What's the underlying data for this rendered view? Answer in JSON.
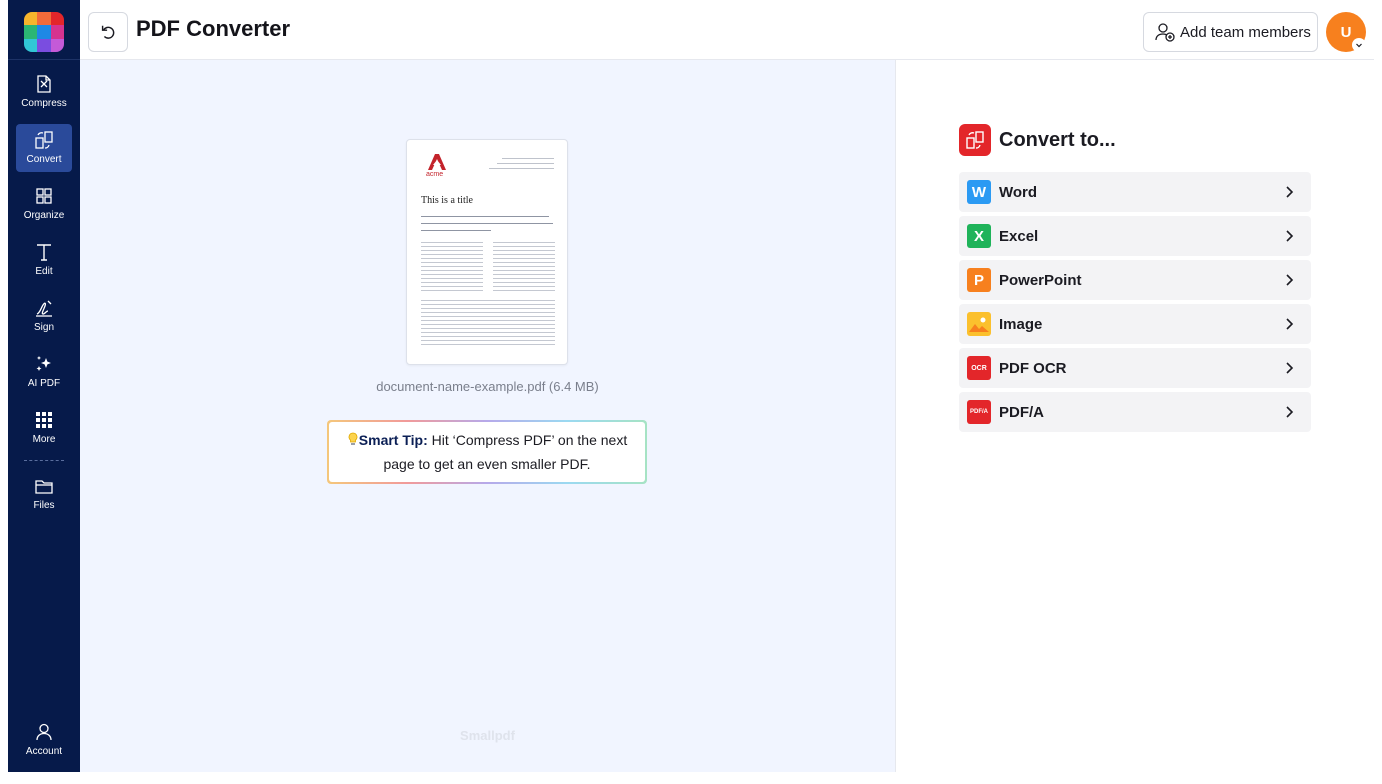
{
  "app": {
    "title": "PDF Converter"
  },
  "sidebar": {
    "items": [
      {
        "label": "Compress",
        "icon": "compress-icon"
      },
      {
        "label": "Convert",
        "icon": "convert-icon",
        "active": true
      },
      {
        "label": "Organize",
        "icon": "organize-icon"
      },
      {
        "label": "Edit",
        "icon": "edit-icon"
      },
      {
        "label": "Sign",
        "icon": "sign-icon"
      },
      {
        "label": "AI PDF",
        "icon": "sparkle-icon"
      },
      {
        "label": "More",
        "icon": "grid-dots-icon"
      },
      {
        "label": "Files",
        "icon": "folder-icon"
      }
    ],
    "account_label": "Account"
  },
  "header": {
    "team_button_label": "Add team members",
    "avatar_initial": "U"
  },
  "document": {
    "file_name": "document-name-example.pdf (6.4 MB)",
    "preview_title": "This is a title",
    "preview_logo": "acme"
  },
  "tip": {
    "label": "Smart Tip:",
    "text": "Hit ‘Compress PDF’ on the next page to get an even smaller PDF."
  },
  "watermark": "Smallpdf",
  "convert": {
    "title": "Convert to...",
    "options": [
      {
        "label": "Word",
        "icon": "word-icon",
        "glyph": "W",
        "color": "#2b9af3"
      },
      {
        "label": "Excel",
        "icon": "excel-icon",
        "glyph": "X",
        "color": "#1fb35a"
      },
      {
        "label": "PowerPoint",
        "icon": "powerpoint-icon",
        "glyph": "P",
        "color": "#f7801e"
      },
      {
        "label": "Image",
        "icon": "image-icon",
        "glyph": "",
        "color": "#fbc02d"
      },
      {
        "label": "PDF OCR",
        "icon": "pdf-ocr-icon",
        "glyph": "OCR",
        "color": "#e3262a"
      },
      {
        "label": "PDF/A",
        "icon": "pdf-a-icon",
        "glyph": "PDF/A",
        "color": "#e3262a"
      }
    ]
  },
  "colors": {
    "sidebar_bg": "#061a4a",
    "sidebar_active": "#2a4a9a",
    "accent_red": "#e3262a",
    "avatar": "#f7801e"
  }
}
